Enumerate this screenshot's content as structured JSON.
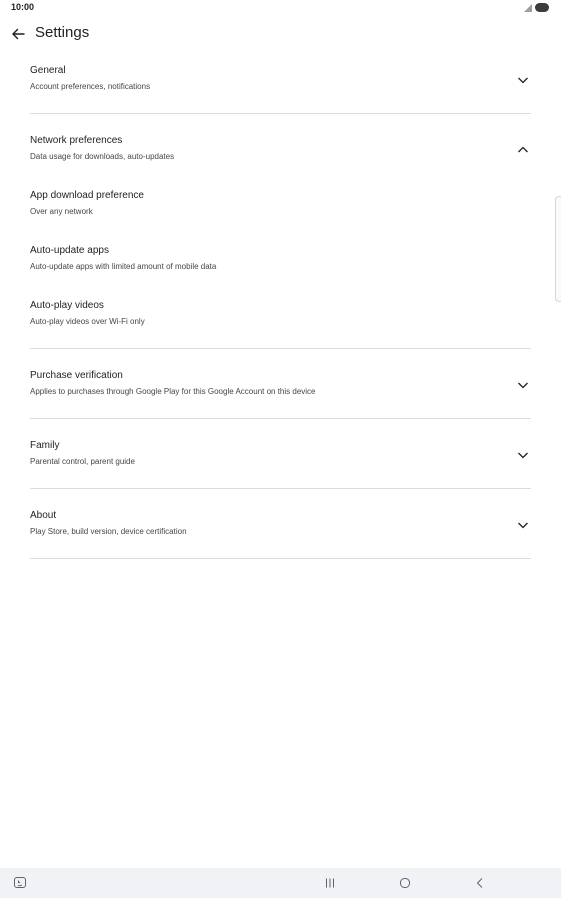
{
  "status": {
    "time": "10:00"
  },
  "header": {
    "title": "Settings"
  },
  "items": [
    {
      "title": "General",
      "subtitle": "Account preferences, notifications",
      "state": "collapsed"
    },
    {
      "title": "Network preferences",
      "subtitle": "Data usage for downloads, auto-updates",
      "state": "expanded"
    },
    {
      "title": "App download preference",
      "subtitle": "Over any network"
    },
    {
      "title": "Auto-update apps",
      "subtitle": "Auto-update apps with limited amount of mobile data"
    },
    {
      "title": "Auto-play videos",
      "subtitle": "Auto-play videos over Wi-Fi only"
    },
    {
      "title": "Purchase verification",
      "subtitle": "Applies to purchases through Google Play for this Google Account on this device",
      "state": "collapsed"
    },
    {
      "title": "Family",
      "subtitle": "Parental control, parent guide",
      "state": "collapsed"
    },
    {
      "title": "About",
      "subtitle": "Play Store, build version, device certification",
      "state": "collapsed"
    }
  ],
  "icons": {
    "back": "arrow-left-icon",
    "expand": "chevron-down-icon",
    "collapse": "chevron-up-icon",
    "signal": "signal-icon",
    "battery": "battery-icon",
    "nav_apps": "apps-icon",
    "nav_recents": "recents-icon",
    "nav_home": "home-icon",
    "nav_back": "nav-back-icon"
  },
  "colors": {
    "text": "#1f1f1f",
    "subtext": "#444746",
    "divider": "#dadce0",
    "navbar": "#f0f2f5"
  }
}
